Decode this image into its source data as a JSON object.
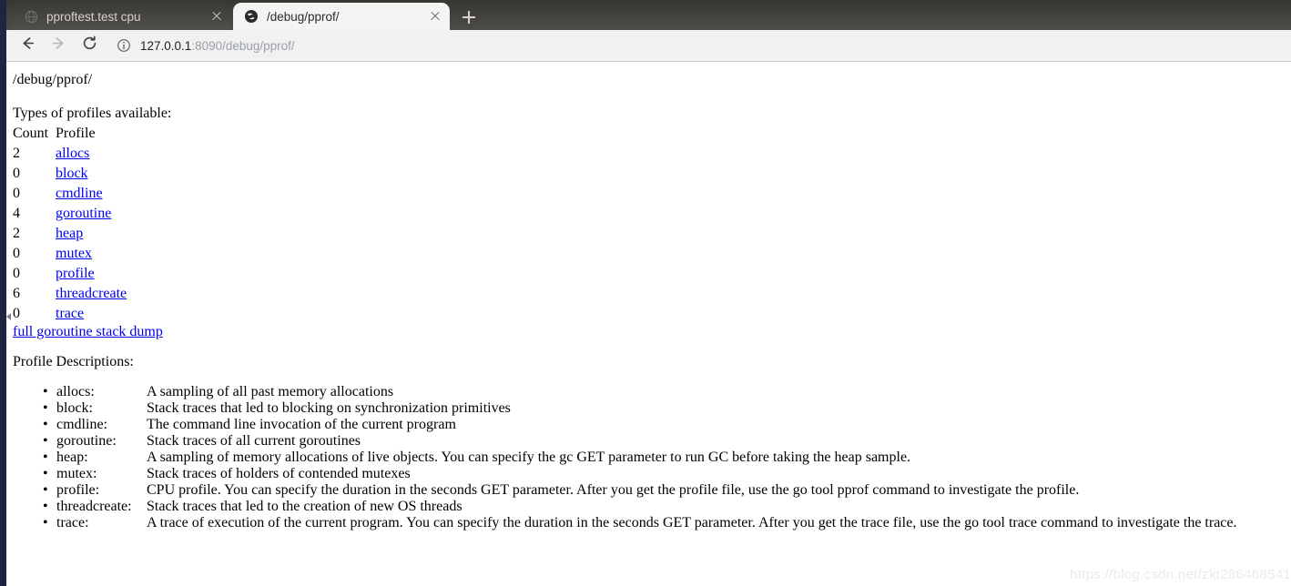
{
  "browser": {
    "tabs": [
      {
        "title": "pproftest.test cpu",
        "favicon": "globe-icon",
        "active": false,
        "close_label": "×"
      },
      {
        "title": "/debug/pprof/",
        "favicon": "globe-icon",
        "active": true,
        "close_label": "×"
      }
    ],
    "new_tab_label": "+",
    "toolbar": {
      "back_icon": "back-arrow-icon",
      "forward_icon": "forward-arrow-icon",
      "reload_icon": "reload-icon",
      "site_info_icon": "info-circle-icon",
      "url_host": "127.0.0.1",
      "url_rest": ":8090/debug/pprof/"
    }
  },
  "page": {
    "heading": "/debug/pprof/",
    "types_line": "Types of profiles available:",
    "table_header": {
      "count": "Count",
      "profile": "Profile"
    },
    "profiles": [
      {
        "count": "2",
        "name": "allocs"
      },
      {
        "count": "0",
        "name": "block"
      },
      {
        "count": "0",
        "name": "cmdline"
      },
      {
        "count": "4",
        "name": "goroutine"
      },
      {
        "count": "2",
        "name": "heap"
      },
      {
        "count": "0",
        "name": "mutex"
      },
      {
        "count": "0",
        "name": "profile"
      },
      {
        "count": "6",
        "name": "threadcreate"
      },
      {
        "count": "0",
        "name": "trace"
      }
    ],
    "full_dump_link": "full goroutine stack dump",
    "descriptions_title": "Profile Descriptions:",
    "descriptions": [
      {
        "term": "allocs:",
        "def": "A sampling of all past memory allocations"
      },
      {
        "term": "block:",
        "def": "Stack traces that led to blocking on synchronization primitives"
      },
      {
        "term": "cmdline:",
        "def": "The command line invocation of the current program"
      },
      {
        "term": "goroutine:",
        "def": "Stack traces of all current goroutines"
      },
      {
        "term": "heap:",
        "def": "A sampling of memory allocations of live objects. You can specify the gc GET parameter to run GC before taking the heap sample."
      },
      {
        "term": "mutex:",
        "def": "Stack traces of holders of contended mutexes"
      },
      {
        "term": "profile:",
        "def": "CPU profile. You can specify the duration in the seconds GET parameter. After you get the profile file, use the go tool pprof command to investigate the profile."
      },
      {
        "term": "threadcreate:",
        "def": "Stack traces that led to the creation of new OS threads"
      },
      {
        "term": "trace:",
        "def": "A trace of execution of the current program. You can specify the duration in the seconds GET parameter. After you get the trace file, use the go tool trace command to investigate the trace."
      }
    ],
    "bullet_glyph": "•",
    "watermark": "https://blog.csdn.net/zkt286468541"
  },
  "colors": {
    "link": "#0000ee",
    "tabstrip": "#45433e",
    "toolbar": "#f1f1f2",
    "edge_strip": "#1f2440"
  }
}
